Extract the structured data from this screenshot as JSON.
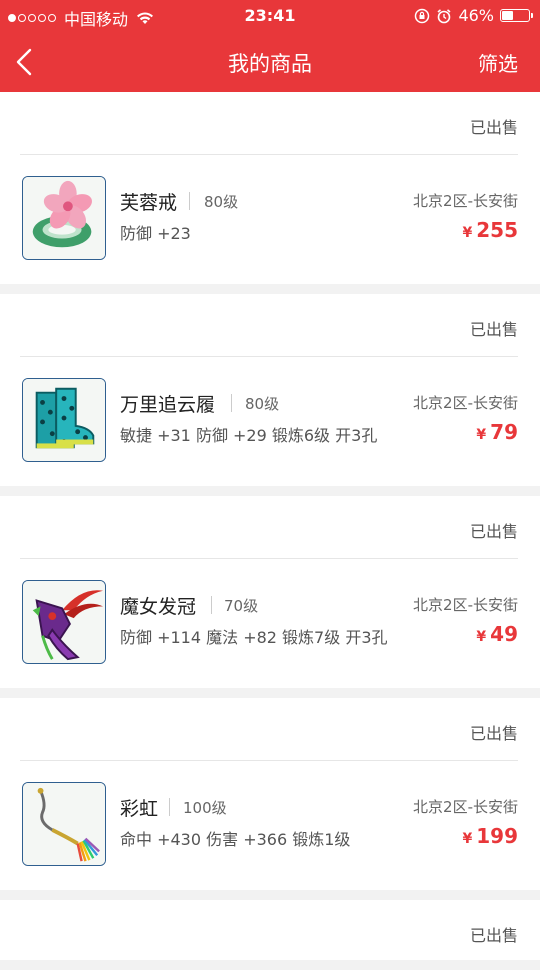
{
  "status_bar": {
    "carrier": "中国移动",
    "time": "23:41",
    "battery": "46%",
    "battery_level": 0.46
  },
  "nav": {
    "title": "我的商品",
    "filter_label": "筛选"
  },
  "items": [
    {
      "status": "已出售",
      "name": "芙蓉戒",
      "level": "80级",
      "attrs": "防御 +23",
      "server": "北京2区-长安街",
      "currency": "¥",
      "price": "255",
      "icon": "jade-ring-flower-icon"
    },
    {
      "status": "已出售",
      "name": "万里追云履",
      "level": "80级",
      "attrs": "敏捷 +31 防御 +29 锻炼6级 开3孔",
      "server": "北京2区-长安街",
      "currency": "¥",
      "price": "79",
      "icon": "teal-boots-icon"
    },
    {
      "status": "已出售",
      "name": "魔女发冠",
      "level": "70级",
      "attrs": "防御 +114 魔法 +82 锻炼7级 开3孔",
      "server": "北京2区-长安街",
      "currency": "¥",
      "price": "49",
      "icon": "witch-crown-icon"
    },
    {
      "status": "已出售",
      "name": "彩虹",
      "level": "100级",
      "attrs": "命中 +430 伤害 +366 锻炼1级",
      "server": "北京2区-长安街",
      "currency": "¥",
      "price": "199",
      "icon": "rainbow-whip-icon"
    },
    {
      "status": "已出售"
    }
  ],
  "colors": {
    "accent": "#e8373a",
    "background": "#f2f2f2",
    "thumb_border": "#2f5f8f"
  }
}
